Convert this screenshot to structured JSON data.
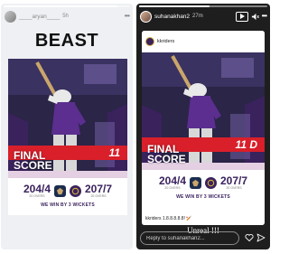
{
  "left_story": {
    "username": "____aryan____",
    "timestamp": "5h",
    "progress": 0.9,
    "heading": "BEAST",
    "post": {
      "final_score_line1": "FINAL",
      "final_score_line2": "SCORE",
      "ad_text": "11",
      "team1_score": "204/4",
      "team1_overs": "20 OVERS",
      "team2_score": "207/7",
      "team2_overs": "20 OVERS",
      "result": "WE WIN BY 3 WICKETS"
    }
  },
  "right_story": {
    "username": "suhanakhan2",
    "timestamp": "27m",
    "progress": 0.55,
    "post": {
      "handle": "kkriders",
      "final_score_line1": "FINAL",
      "final_score_line2": "SCORE",
      "ad_text": "11 D",
      "team1_score": "204/4",
      "team1_overs": "20 OVERS",
      "team2_score": "207/7",
      "team2_overs": "20 OVERS",
      "result": "WE WIN BY 3 WICKETS",
      "caption": "kkriders 1.8.8.8.8.8! 🏏"
    },
    "reply_text": "Unreal !!!",
    "reply_placeholder": "Reply to suhanakhan2..."
  },
  "colors": {
    "kkr_purple": "#3a225d",
    "ad_red": "#d81f2a",
    "gold": "#d4af37"
  }
}
